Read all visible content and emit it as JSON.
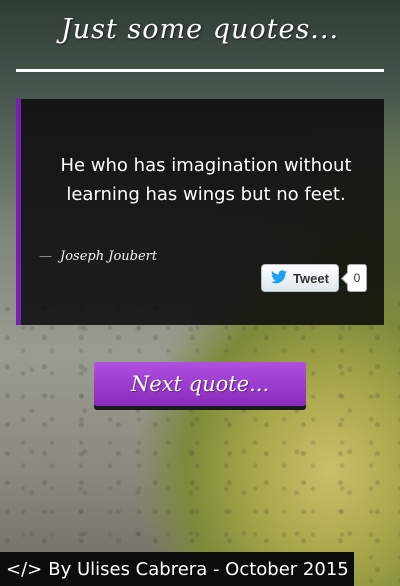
{
  "header": {
    "title": "Just some quotes..."
  },
  "quote": {
    "text": "He who has imagination without learning has wings but no feet.",
    "author_dash": "—",
    "author": "Joseph Joubert"
  },
  "tweet": {
    "label": "Tweet",
    "count": "0",
    "icon": "twitter-bird-icon"
  },
  "actions": {
    "next_label": "Next quote..."
  },
  "footer": {
    "code_glyph": "</>",
    "text": "By Ulises Cabrera - October 2015"
  },
  "colors": {
    "accent": "#8a2bbd",
    "card": "#0c0c0c"
  }
}
